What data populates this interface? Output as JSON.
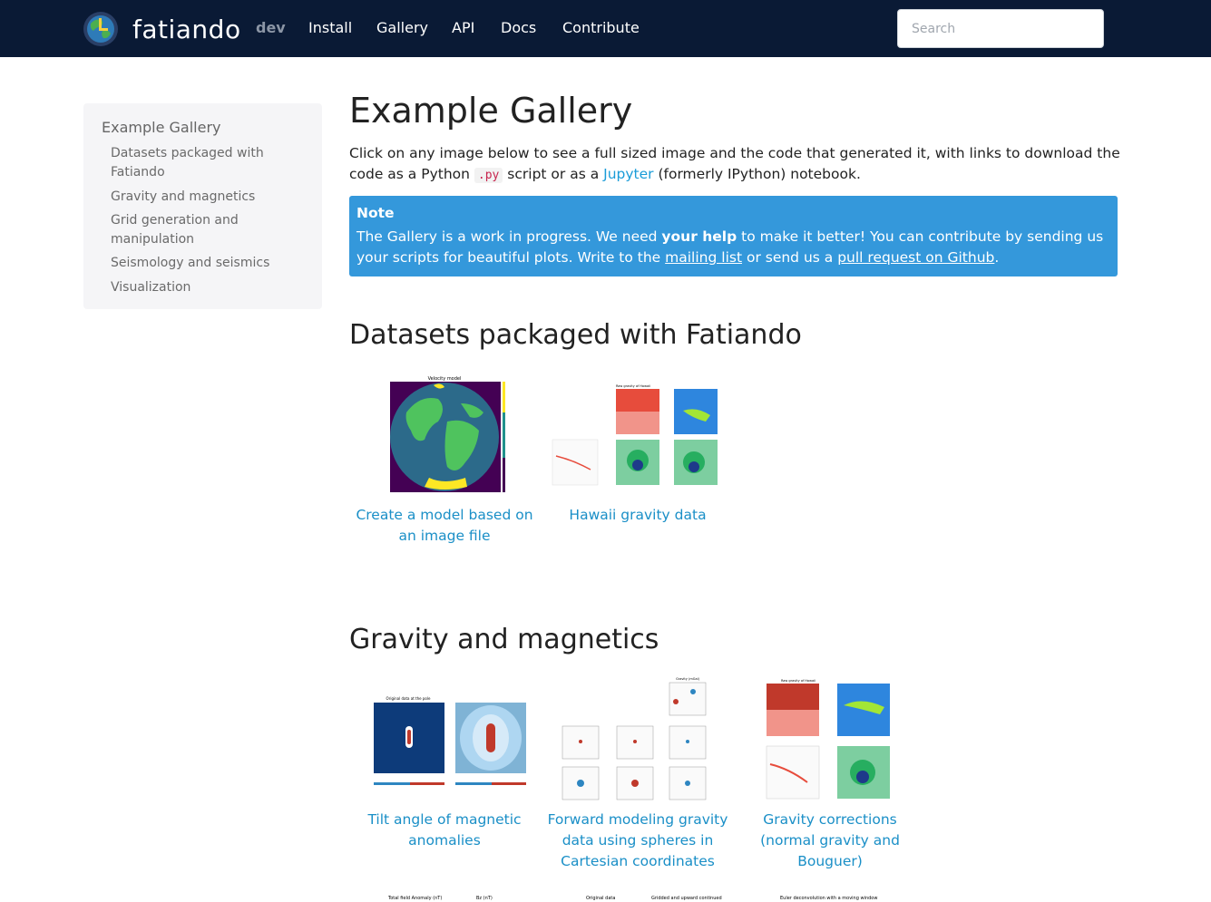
{
  "navbar": {
    "brand": "fatiando",
    "version": "dev",
    "links": [
      "Install",
      "Gallery",
      "API",
      "Docs",
      "Contribute"
    ],
    "search_placeholder": "Search"
  },
  "sidebar": {
    "title": "Example Gallery",
    "items": [
      "Datasets packaged with Fatiando",
      "Gravity and magnetics",
      "Grid generation and manipulation",
      "Seismology and seismics",
      "Visualization"
    ]
  },
  "main": {
    "title": "Example Gallery",
    "intro_part1": "Click on any image below to see a full sized image and the code that generated it, with links to download the code as a Python ",
    "intro_code": ".py",
    "intro_part2": " script or as a ",
    "intro_link": "Jupyter",
    "intro_part3": " (formerly IPython) notebook.",
    "note": {
      "title": "Note",
      "text1": "The Gallery is a work in progress. We need ",
      "bold": "your help",
      "text2": " to make it better! You can contribute by sending us your scripts for beautiful plots. Write to the ",
      "link1": "mailing list",
      "text3": " or send us a ",
      "link2": "pull request on Github",
      "text4": "."
    },
    "sections": [
      {
        "title": "Datasets packaged with Fatiando",
        "examples": [
          {
            "caption": "Create a model based on an image file",
            "thumb_title": "Velocity model"
          },
          {
            "caption": "Hawaii gravity data",
            "thumb_title": "Raw gravity of Hawaii"
          }
        ]
      },
      {
        "title": "Gravity and magnetics",
        "examples": [
          {
            "caption": "Tilt angle of magnetic anomalies",
            "thumb_title": "Original data at the pole"
          },
          {
            "caption": "Forward modeling gravity data using spheres in Cartesian coordinates",
            "thumb_title": "Gravity (mGal)"
          },
          {
            "caption": "Gravity corrections (normal gravity and Bouguer)",
            "thumb_title": "Raw gravity of Hawaii"
          }
        ]
      }
    ],
    "next_row_titles": [
      "Total field Anomaly (nT)",
      "Bz (nT)",
      "Original data",
      "Gridded and upward continued",
      "Euler deconvolution with a moving window"
    ]
  },
  "colors": {
    "navbar_bg": "#0a1a35",
    "note_bg": "#3498db",
    "link": "#1a8fc7",
    "sidebar_bg": "#f5f5f7"
  }
}
